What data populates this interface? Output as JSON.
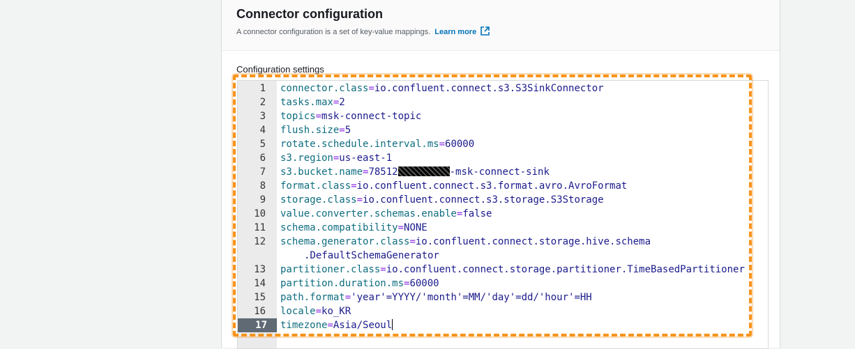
{
  "section": {
    "title": "Connector configuration",
    "description": "A connector configuration is a set of key-value mappings.",
    "learn_more": "Learn more",
    "settings_label": "Configuration settings"
  },
  "editor": {
    "active_line": "17",
    "lines": [
      {
        "n": "1",
        "key": "connector.class",
        "value": "io.confluent.connect.s3.S3SinkConnector"
      },
      {
        "n": "2",
        "key": "tasks.max",
        "value": "2"
      },
      {
        "n": "3",
        "key": "topics",
        "value": "msk-connect-topic"
      },
      {
        "n": "4",
        "key": "flush.size",
        "value": "5"
      },
      {
        "n": "5",
        "key": "rotate.schedule.interval.ms",
        "value": "60000"
      },
      {
        "n": "6",
        "key": "s3.region",
        "value": "us-east-1"
      },
      {
        "n": "7",
        "key": "s3.bucket.name",
        "value_prefix": "78512",
        "value_suffix": "-msk-connect-sink"
      },
      {
        "n": "8",
        "key": "format.class",
        "value": "io.confluent.connect.s3.format.avro.AvroFormat"
      },
      {
        "n": "9",
        "key": "storage.class",
        "value": "io.confluent.connect.s3.storage.S3Storage"
      },
      {
        "n": "10",
        "key": "value.converter.schemas.enable",
        "value": "false"
      },
      {
        "n": "11",
        "key": "schema.compatibility",
        "value": "NONE"
      },
      {
        "n": "12",
        "key": "schema.generator.class",
        "value": "io.confluent.connect.storage.hive.schema",
        "wrap": ".DefaultSchemaGenerator"
      },
      {
        "n": "13",
        "key": "partitioner.class",
        "value": "io.confluent.connect.storage.partitioner.TimeBasedPartitioner"
      },
      {
        "n": "14",
        "key": "partition.duration.ms",
        "value": "60000"
      },
      {
        "n": "15",
        "key": "path.format",
        "value": "'year'=YYYY/'month'=MM/'day'=dd/'hour'=HH"
      },
      {
        "n": "16",
        "key": "locale",
        "value": "ko_KR"
      },
      {
        "n": "17",
        "key": "timezone",
        "value": "Asia/Seoul"
      }
    ]
  },
  "colors": {
    "highlight": "#f7941d",
    "link": "#0073bb"
  }
}
